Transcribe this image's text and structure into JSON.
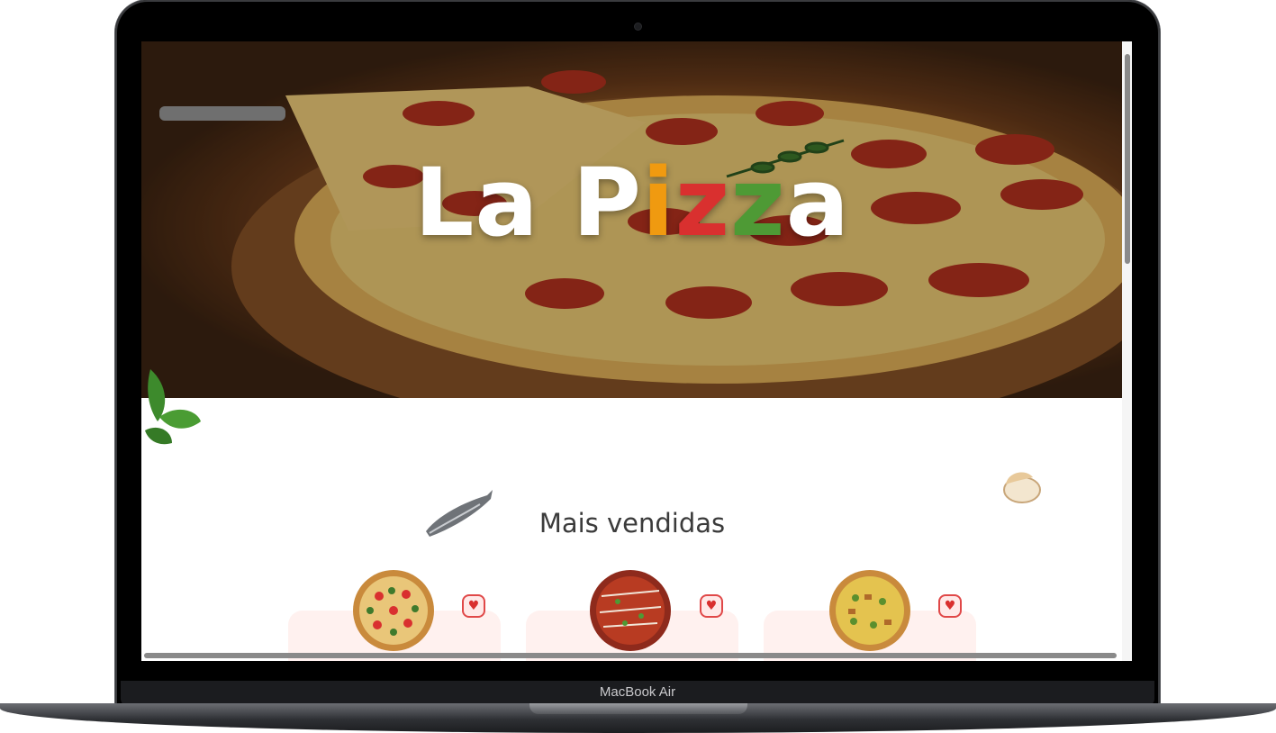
{
  "hero": {
    "title_parts": [
      "La P",
      "i",
      "z",
      "z",
      "a"
    ],
    "colors": {
      "letter_i": "#f09a10",
      "letter_z1": "#d9302f",
      "letter_z2": "#4e9a35",
      "base": "#ffffff"
    }
  },
  "section": {
    "title": "Mais vendidas"
  },
  "cards": [
    {
      "image": "pizza-vegetable-icon",
      "favorite_icon": "heart-icon"
    },
    {
      "image": "pizza-pepperoni-icon",
      "favorite_icon": "heart-icon"
    },
    {
      "image": "pizza-cheese-icon",
      "favorite_icon": "heart-icon"
    }
  ],
  "favorite_glyph": "♥",
  "device": {
    "label": "MacBook Air"
  },
  "decorations": [
    "basil-leaf-icon",
    "fish-icon",
    "mushroom-icon"
  ]
}
